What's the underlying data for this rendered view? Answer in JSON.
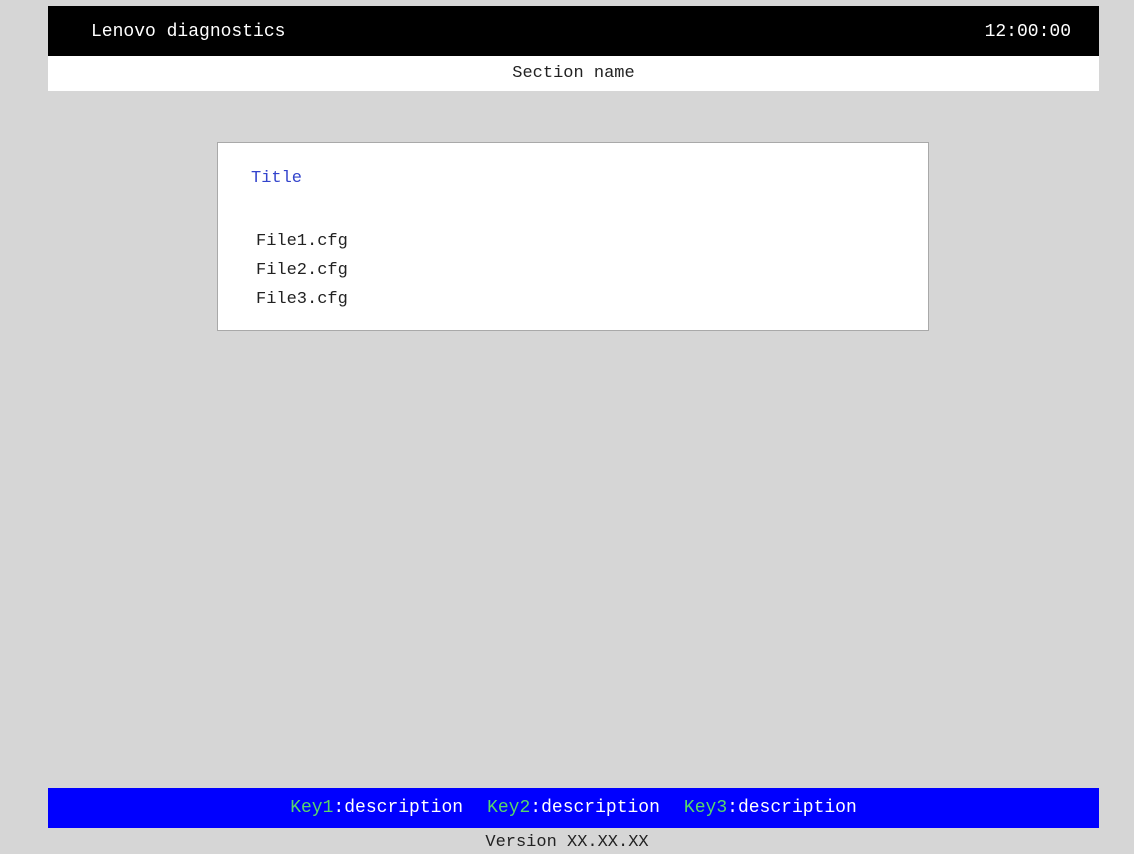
{
  "header": {
    "app_title": "Lenovo diagnostics",
    "clock": "12:00:00"
  },
  "section": {
    "name": "Section name"
  },
  "panel": {
    "title": "Title",
    "files": [
      "File1.cfg",
      "File2.cfg",
      "File3.cfg"
    ]
  },
  "footer": {
    "keys": [
      {
        "key": "Key1",
        "separator": ":",
        "description": "description"
      },
      {
        "key": "Key2",
        "separator": ":",
        "description": "description"
      },
      {
        "key": "Key3",
        "separator": ":",
        "description": "description"
      }
    ],
    "version": "Version XX.XX.XX"
  },
  "colors": {
    "background": "#d6d6d6",
    "header_bg": "#000000",
    "footer_bg": "#0000ff",
    "panel_title": "#3344cc",
    "key_name": "#58d66a"
  }
}
